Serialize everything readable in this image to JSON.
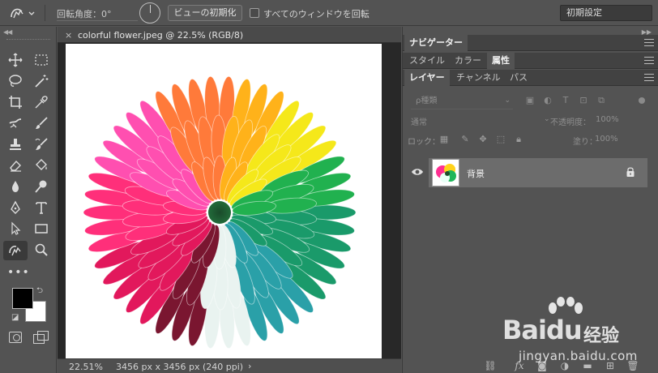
{
  "options_bar": {
    "rotation_label": "回転角度：0°",
    "reset_view_label": "ビューの初期化",
    "rotate_all_windows_label": "すべてのウィンドウを回転",
    "rotate_all_windows_checked": false,
    "workspace_label": "初期設定"
  },
  "toolbar": {
    "collapse_icon": "double-chevron-left-icon",
    "tools": [
      "move",
      "marquee",
      "lasso",
      "quick-select",
      "crop",
      "eyedropper",
      "healing",
      "brush",
      "clone-stamp",
      "history-brush",
      "eraser",
      "paint-bucket",
      "blur",
      "dodge",
      "pen",
      "type",
      "path-select",
      "rectangle",
      "rotate-view",
      "zoom"
    ],
    "active_tool": "rotate-view",
    "more_label": "•••",
    "foreground_color": "#000000",
    "background_color": "#ffffff"
  },
  "document": {
    "tab_title": "colorful flower.jpeg @ 22.5% (RGB/8)",
    "tab_close": "×",
    "status_zoom": "22.51%",
    "status_info": "3456 px x 3456 px (240 ppi)",
    "status_arrow": "›"
  },
  "panels": {
    "top_tabs": [
      {
        "label": "ナビゲーター",
        "active": true
      }
    ],
    "mid_tabs": [
      {
        "label": "スタイル",
        "active": false
      },
      {
        "label": "カラー",
        "active": false
      },
      {
        "label": "属性",
        "active": true
      }
    ],
    "layer_tabs": [
      {
        "label": "レイヤー",
        "active": true
      },
      {
        "label": "チャンネル",
        "active": false
      },
      {
        "label": "パス",
        "active": false
      }
    ],
    "filter_kind": "ρ種類",
    "blend_mode": "通常",
    "opacity_label": "不透明度：",
    "opacity_value": "100%",
    "lock_label": "ロック：",
    "fill_label": "塗り：",
    "fill_value": "100%",
    "layers": [
      {
        "name": "背景",
        "visible": true,
        "locked": true,
        "selected": true
      }
    ]
  },
  "watermark": {
    "brand": "Baidu",
    "cn": "经验",
    "url": "jingyan.baidu.com"
  }
}
